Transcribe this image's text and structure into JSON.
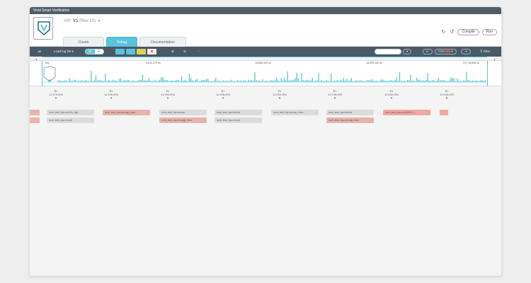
{
  "window": {
    "title": "Vivid Smart Verification"
  },
  "header": {
    "vip_prefix": "VIP:",
    "vip_name": "V1",
    "vip_rev": "(Rev 10)",
    "tabs": [
      {
        "label": "Create"
      },
      {
        "label": "Debug"
      },
      {
        "label": "Documentation"
      }
    ],
    "compile_label": "Compile",
    "run_label": "Run"
  },
  "toolbar": {
    "log_file_label": "Load log file ▾",
    "toggle_options": [
      "all",
      "☰"
    ],
    "filter_label": "Filter",
    "first_label": "First",
    "search_dropdown": "▾",
    "colors": {
      "teal": "#59c3db",
      "yellow": "#d9d35a",
      "red": "#e05a4f",
      "bar": "#4a5968"
    }
  },
  "timeline": {
    "axis_labels": [
      "0ns",
      "4,612,379 ns",
      "15,866,309 ns",
      "18,209,152 ns",
      "23,718,698 ns"
    ]
  },
  "ticks": [
    {
      "id": "$1",
      "value": "11,479,000"
    },
    {
      "id": "$1",
      "value": "11,490,000"
    },
    {
      "id": "$1",
      "value": "11,994,000"
    },
    {
      "id": "$1",
      "value": "11,998,000"
    },
    {
      "id": "$1",
      "value": "12,002,000"
    },
    {
      "id": "$1",
      "value": "12,198,000"
    },
    {
      "id": "$1",
      "value": "12,532,000"
    },
    {
      "id": "$1",
      "value": "12,534,000"
    }
  ],
  "cards": {
    "row1": [
      {
        "text": "",
        "tone": "r"
      },
      {
        "text": "uvm_test_top.env.i2c_agt...",
        "tone": "g"
      },
      {
        "text": "uvm_test_top.env.agt_mon...",
        "tone": "r"
      },
      {
        "text": "uvm_test_top.env.sb",
        "tone": "g"
      },
      {
        "text": "uvm_test_top.env.sb",
        "tone": "g"
      },
      {
        "text": "uvm_test_top.env.sb_mon...",
        "tone": "g"
      },
      {
        "text": "uvm_test_top.env.sb",
        "tone": "g"
      },
      {
        "text": "uvm_test_top.env.BASE_I...",
        "tone": "rr"
      },
      {
        "text": "",
        "tone": "rr"
      }
    ],
    "row2": [
      {
        "text": "",
        "tone": "r"
      },
      {
        "text": "uvm_test_top.env.sb",
        "tone": "g"
      },
      {
        "text": "uvm_test_top.env.agt_mon",
        "tone": "r"
      },
      {
        "text": "uvm_test_top.env.sb",
        "tone": "g"
      },
      {
        "text": "uvm_test_top.env.agt_mon",
        "tone": "r"
      }
    ]
  }
}
